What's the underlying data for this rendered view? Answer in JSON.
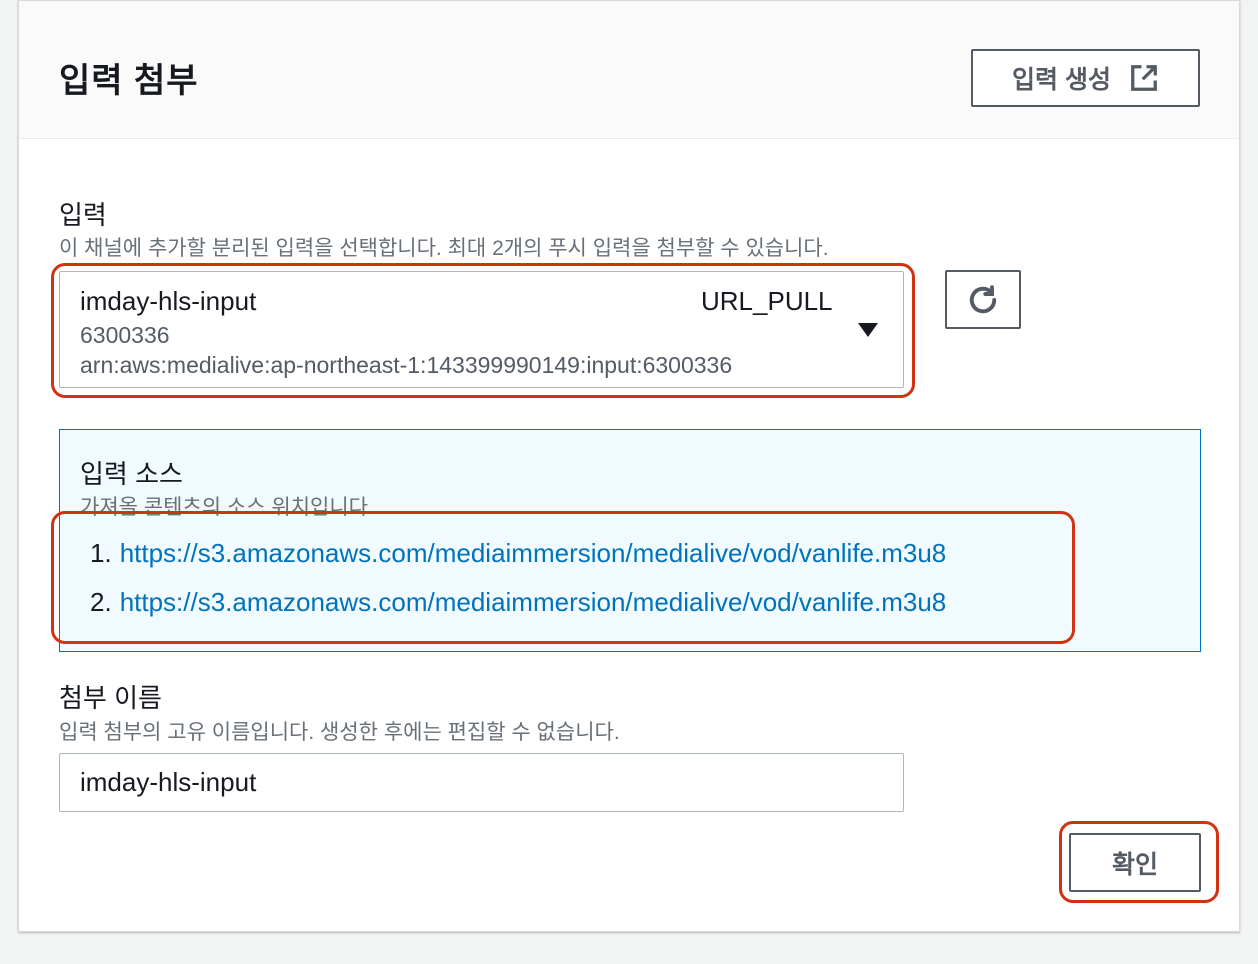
{
  "header": {
    "title": "입력 첨부",
    "create_button_label": "입력 생성"
  },
  "input_section": {
    "label": "입력",
    "description": "이 채널에 추가할 분리된 입력을 선택합니다. 최대 2개의 푸시 입력을 첨부할 수 있습니다.",
    "selected": {
      "name": "imday-hls-input",
      "type": "URL_PULL",
      "id": "6300336",
      "arn": "arn:aws:medialive:ap-northeast-1:143399990149:input:6300336"
    }
  },
  "source_info": {
    "title": "입력 소스",
    "description": "가져올 콘텐츠의 소스 위치입니다.",
    "sources": [
      {
        "index": "1.",
        "url": "https://s3.amazonaws.com/mediaimmersion/medialive/vod/vanlife.m3u8"
      },
      {
        "index": "2.",
        "url": "https://s3.amazonaws.com/mediaimmersion/medialive/vod/vanlife.m3u8"
      }
    ]
  },
  "attachment_name": {
    "label": "첨부 이름",
    "description": "입력 첨부의 고유 이름입니다. 생성한 후에는 편집할 수 없습니다.",
    "value": "imday-hls-input"
  },
  "footer": {
    "confirm_label": "확인"
  },
  "colors": {
    "highlight": "#d13212",
    "link": "#0073bb",
    "info_bg": "#f1faff"
  },
  "icons": {
    "create": "external-link-icon",
    "refresh": "refresh-icon",
    "dropdown": "caret-down-icon"
  }
}
